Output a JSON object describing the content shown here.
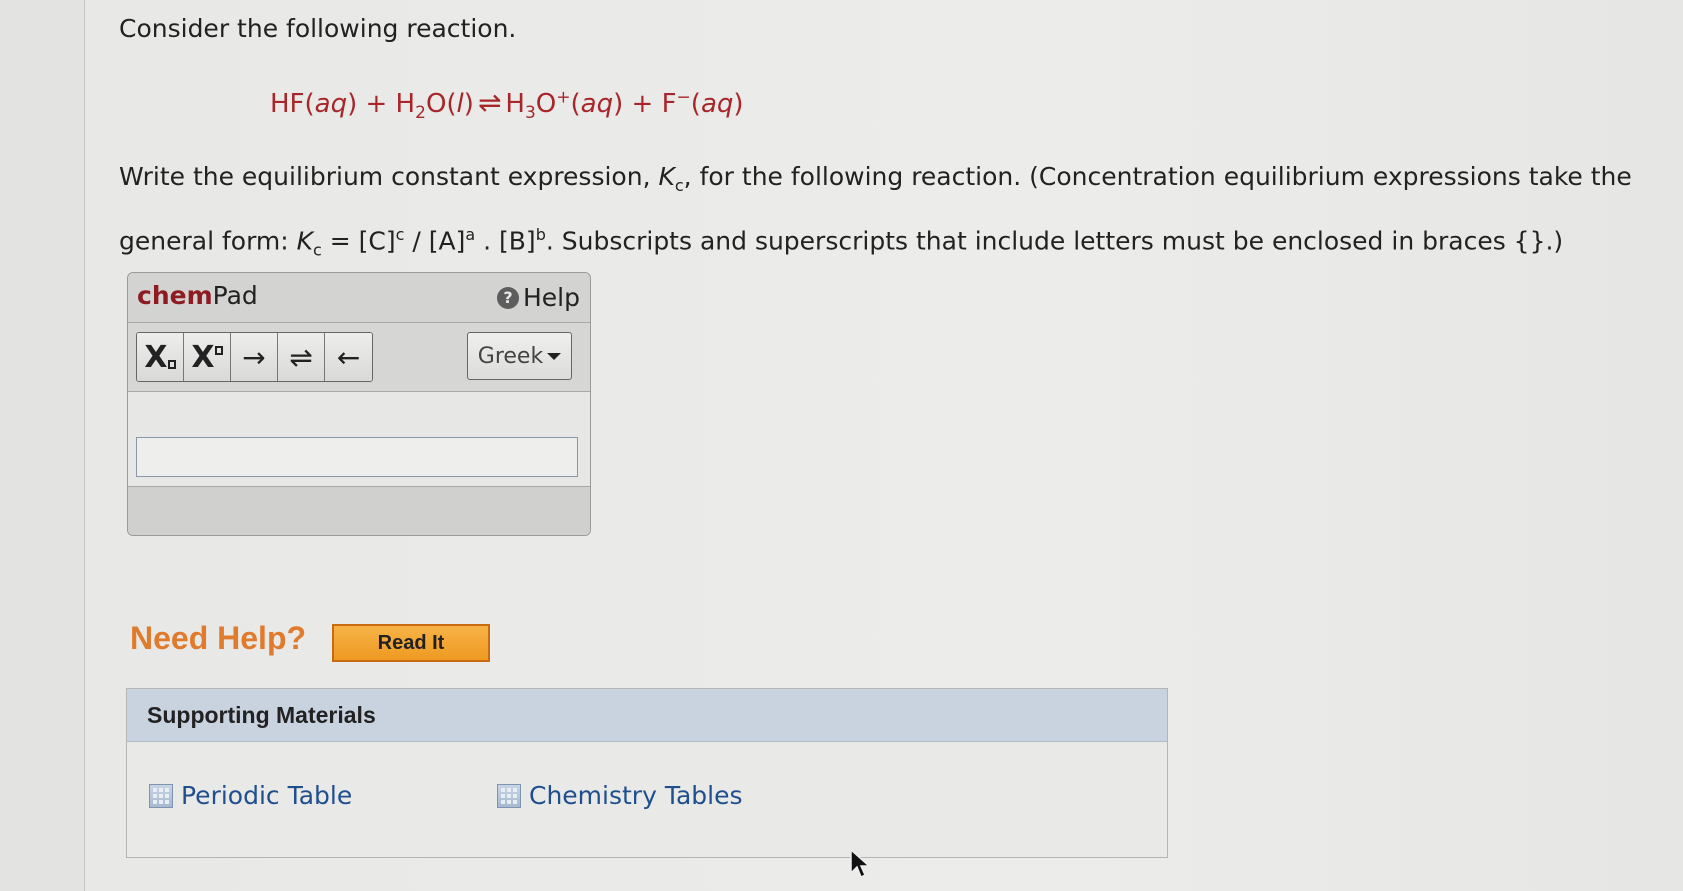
{
  "intro": "Consider the following reaction.",
  "reaction": {
    "r1": "HF(",
    "r1_state": "aq",
    "r1_close": ") + H",
    "r2_sub": "2",
    "r2": "O(",
    "r2_state": "l",
    "r2_close": ")",
    "arrow": "⇌",
    "p1": "H",
    "p1_sub": "3",
    "p1_o": "O",
    "p1_sup": "+",
    "p1_open": "(",
    "p1_state": "aq",
    "p1_close": ") + F",
    "p2_sup": "−",
    "p2_open": "(",
    "p2_state": "aq",
    "p2_close": ")"
  },
  "question": {
    "part1": "Write the equilibrium constant expression, ",
    "k": "K",
    "k_sub": "c",
    "part2": ", for the following reaction. (Concentration equilibrium expressions take the general form: ",
    "k2": "K",
    "k2_sub": "c",
    "part3": " = [C]",
    "c_sup": "c",
    "part4": " / [A]",
    "a_sup": "a",
    "part5": " . [B]",
    "b_sup": "b",
    "part6": ". Subscripts and superscripts that include letters must be enclosed in braces {}.)"
  },
  "chempad": {
    "brand": "chem",
    "title_rest": "Pad",
    "help_label": "Help",
    "tools": {
      "subscript": "X",
      "superscript": "X",
      "forward_arrow": "→",
      "equilibrium_arrow": "⇌",
      "back_arrow": "←"
    },
    "greek_label": "Greek",
    "input_value": ""
  },
  "need_help": {
    "label": "Need Help?",
    "read_it": "Read It"
  },
  "supporting": {
    "header": "Supporting Materials",
    "links": [
      "Periodic Table",
      "Chemistry Tables"
    ]
  },
  "colors": {
    "reaction_red": "#a8262a",
    "brand_red": "#8e1b22",
    "need_help_orange": "#e07a2c",
    "read_it_button": "#ee9a22",
    "link_blue": "#1f4f8f",
    "supporting_header": "#c9d2df"
  },
  "icons": [
    "help-icon",
    "table-icon",
    "mouse-pointer-icon",
    "caret-down-icon"
  ]
}
